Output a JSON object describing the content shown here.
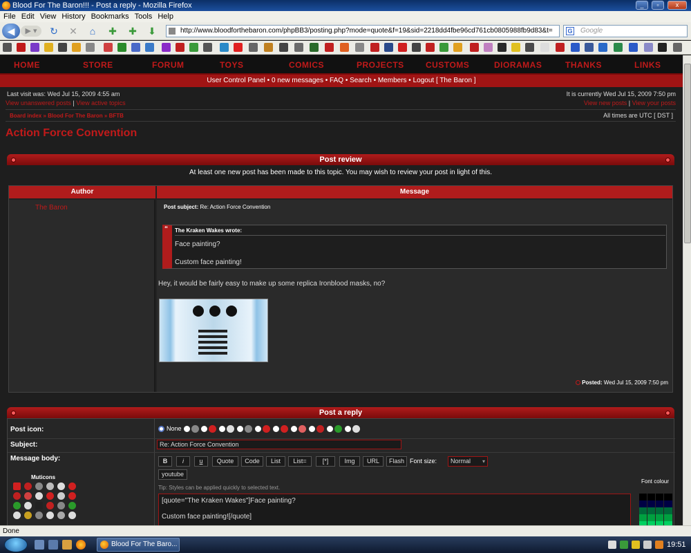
{
  "window": {
    "title": "Blood For The Baron!!! - Post a reply - Mozilla Firefox"
  },
  "menu": [
    "File",
    "Edit",
    "View",
    "History",
    "Bookmarks",
    "Tools",
    "Help"
  ],
  "nav": {
    "url": "http://www.bloodforthebaron.com/phpBB3/posting.php?mode=quote&f=19&sid=2218dd4fbe96cd761cb0805988fb9d83&t=",
    "search_placeholder": "Google",
    "search_engine_letter": "G"
  },
  "site_nav": [
    "HOME",
    "STORE",
    "FORUM",
    "TOYS",
    "COMICS",
    "PROJECTS",
    "CUSTOMS",
    "DIORAMAS",
    "THANKS",
    "LINKS"
  ],
  "user_bar": "User Control Panel • 0 new messages • FAQ • Search • Members • Logout [ The Baron ]",
  "header": {
    "last_visit": "Last visit was: Wed Jul 15, 2009 4:55 am",
    "current_time": "It is currently Wed Jul 15, 2009 7:50 pm",
    "links_left": [
      "View unanswered posts",
      "View active topics"
    ],
    "links_right": [
      "View new posts",
      "View your posts"
    ],
    "breadcrumb": "Board index » Blood For The Baron » BFTB",
    "timezone": "All times are UTC [ DST ]"
  },
  "page_title": "Action Force Convention",
  "post_review": {
    "heading": "Post review",
    "notice": "At least one new post has been made to this topic. You may wish to review your post in light of this.",
    "col_author": "Author",
    "col_message": "Message",
    "author": "The Baron",
    "subject_label": "Post subject:",
    "subject": "Re: Action Force Convention",
    "quote_author": "The Kraken Wakes wrote:",
    "quote_line1": "Face painting?",
    "quote_line2": "Custom face painting!",
    "body": "Hey, it would be fairly easy to make up some replica Ironblood masks, no?",
    "posted_label": "Posted:",
    "posted_date": "Wed Jul 15, 2009 7:50 pm"
  },
  "reply": {
    "heading": "Post a reply",
    "post_icon_label": "Post icon:",
    "none_label": "None",
    "subject_label": "Subject:",
    "subject_value": "Re: Action Force Convention",
    "body_label": "Message body:",
    "muticons_label": "Muticons",
    "buttons": [
      "B",
      "i",
      "u",
      "Quote",
      "Code",
      "List",
      "List=",
      "[*]",
      "Img",
      "URL",
      "Flash"
    ],
    "font_size_label": "Font size:",
    "font_size_value": "Normal",
    "youtube": "youtube",
    "tip": "Tip: Styles can be applied quickly to selected text.",
    "textarea_line1": "[quote=\"The Kraken Wakes\"]Face painting?",
    "textarea_line2": "Custom face painting![/quote]",
    "font_colour_label": "Font colour"
  },
  "status": {
    "text": "Done"
  },
  "taskbar": {
    "window_button": "Blood For The Baro...",
    "clock": "19:51"
  },
  "colors": {
    "accent_red": "#b01c1c",
    "link_red": "#c01a1a",
    "bg_dark": "#1e1e1e"
  }
}
